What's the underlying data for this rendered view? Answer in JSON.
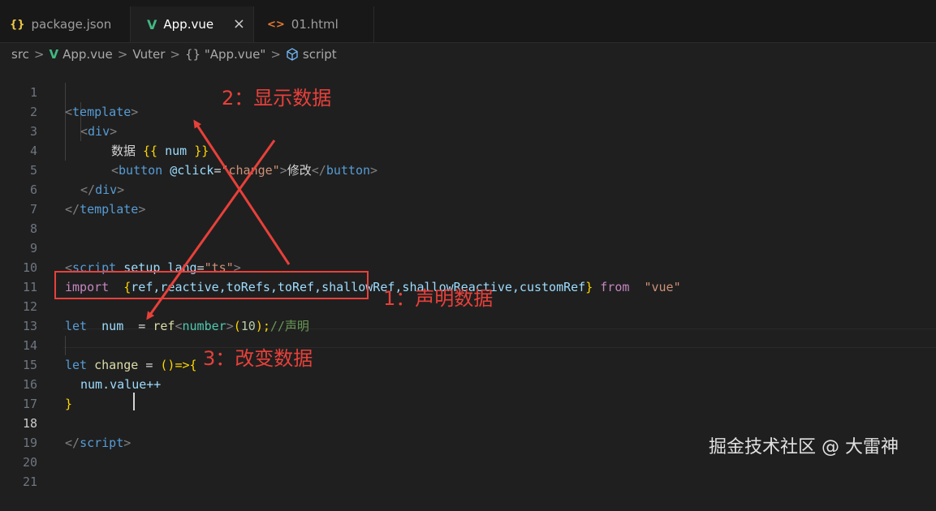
{
  "tabs": [
    {
      "icon": "{}",
      "label": "package.json",
      "active": false
    },
    {
      "icon": "V",
      "label": "App.vue",
      "active": true,
      "close": "×"
    },
    {
      "icon": "<>",
      "label": "01.html",
      "active": false
    }
  ],
  "breadcrumb": [
    "src",
    "App.vue",
    "Vuter",
    "{} \"App.vue\"",
    "script"
  ],
  "breadcrumb_sep": ">",
  "line_numbers": [
    "1",
    "2",
    "3",
    "4",
    "5",
    "6",
    "7",
    "8",
    "9",
    "10",
    "11",
    "12",
    "13",
    "14",
    "15",
    "16",
    "17",
    "18",
    "19",
    "20",
    "21"
  ],
  "current_line": 18,
  "code": {
    "l1": {
      "open": "<",
      "tag": "template",
      "close": ">"
    },
    "l2": {
      "open": "<",
      "tag": "div",
      "close": ">"
    },
    "l3": {
      "text": "数据 ",
      "mo": "{{",
      "var": " num ",
      "mc": "}}"
    },
    "l4": {
      "open": "<",
      "tag": "button",
      "attr": " @click",
      "eq": "=",
      "str": "\"change\"",
      "close": ">",
      "text": "修改",
      "open2": "</",
      "tag2": "button",
      "close2": ">"
    },
    "l5": {
      "open": "</",
      "tag": "div",
      "close": ">"
    },
    "l6": {
      "open": "</",
      "tag": "template",
      "close": ">"
    },
    "l9": {
      "open": "<",
      "tag": "script",
      "attr1": " setup",
      "attr2": " lang",
      "eq": "=",
      "str": "\"ts\"",
      "close": ">"
    },
    "l10": {
      "kw": "import",
      "sp": "  ",
      "ob": "{",
      "names": "ref,reactive,toRefs,toRef,shallowRef,shallowReactive,customRef",
      "cb": "}",
      "from": " from",
      "str": "  \"vue\""
    },
    "l12": {
      "kw": "let",
      "var": "  num",
      "eq": "  = ",
      "fn": "ref",
      "lt": "<",
      "type": "number",
      "gt": ">",
      "po": "(",
      "num": "10",
      "pc": ");",
      "cmt": "//声明"
    },
    "l14": {
      "kw": "let",
      "var": " change",
      "eq": " = ",
      "ar": "()=>",
      "ob": "{"
    },
    "l15": {
      "text": "num.value++"
    },
    "l16": {
      "cb": "}"
    },
    "l18": {
      "open": "</",
      "tag": "script",
      "close": ">"
    }
  },
  "annotations": {
    "a1": "1：声明数据",
    "a2": "2：显示数据",
    "a3": "3：改变数据"
  },
  "watermark": "掘金技术社区 @ 大雷神",
  "colors": {
    "annotation": "#e8403a",
    "vue": "#41b883",
    "json": "#e8c547",
    "html": "#e37933"
  }
}
